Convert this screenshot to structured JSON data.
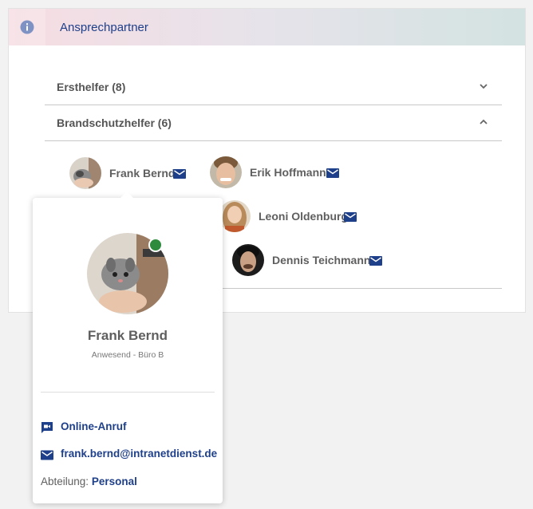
{
  "header": {
    "title": "Ansprechpartner",
    "icon": "info-icon"
  },
  "accordion": {
    "sections": [
      {
        "label": "Ersthelfer (8)",
        "expanded": false
      },
      {
        "label": "Brandschutzhelfer (6)",
        "expanded": true
      }
    ]
  },
  "people": [
    {
      "name": "Frank Bernd"
    },
    {
      "name": "Erik Hoffmann"
    },
    {
      "name": "Leoni Oldenburg"
    },
    {
      "name": "Dennis Teichmann"
    }
  ],
  "popup": {
    "name": "Frank Bernd",
    "status": "Anwesend - Büro B",
    "status_color": "#2e8b3e",
    "call_label": "Online-Anruf",
    "email": "frank.bernd@intranetdienst.de",
    "department_label": "Abteilung:",
    "department_value": "Personal"
  },
  "colors": {
    "accent": "#1e3f8a",
    "online": "#2e8b3e"
  }
}
